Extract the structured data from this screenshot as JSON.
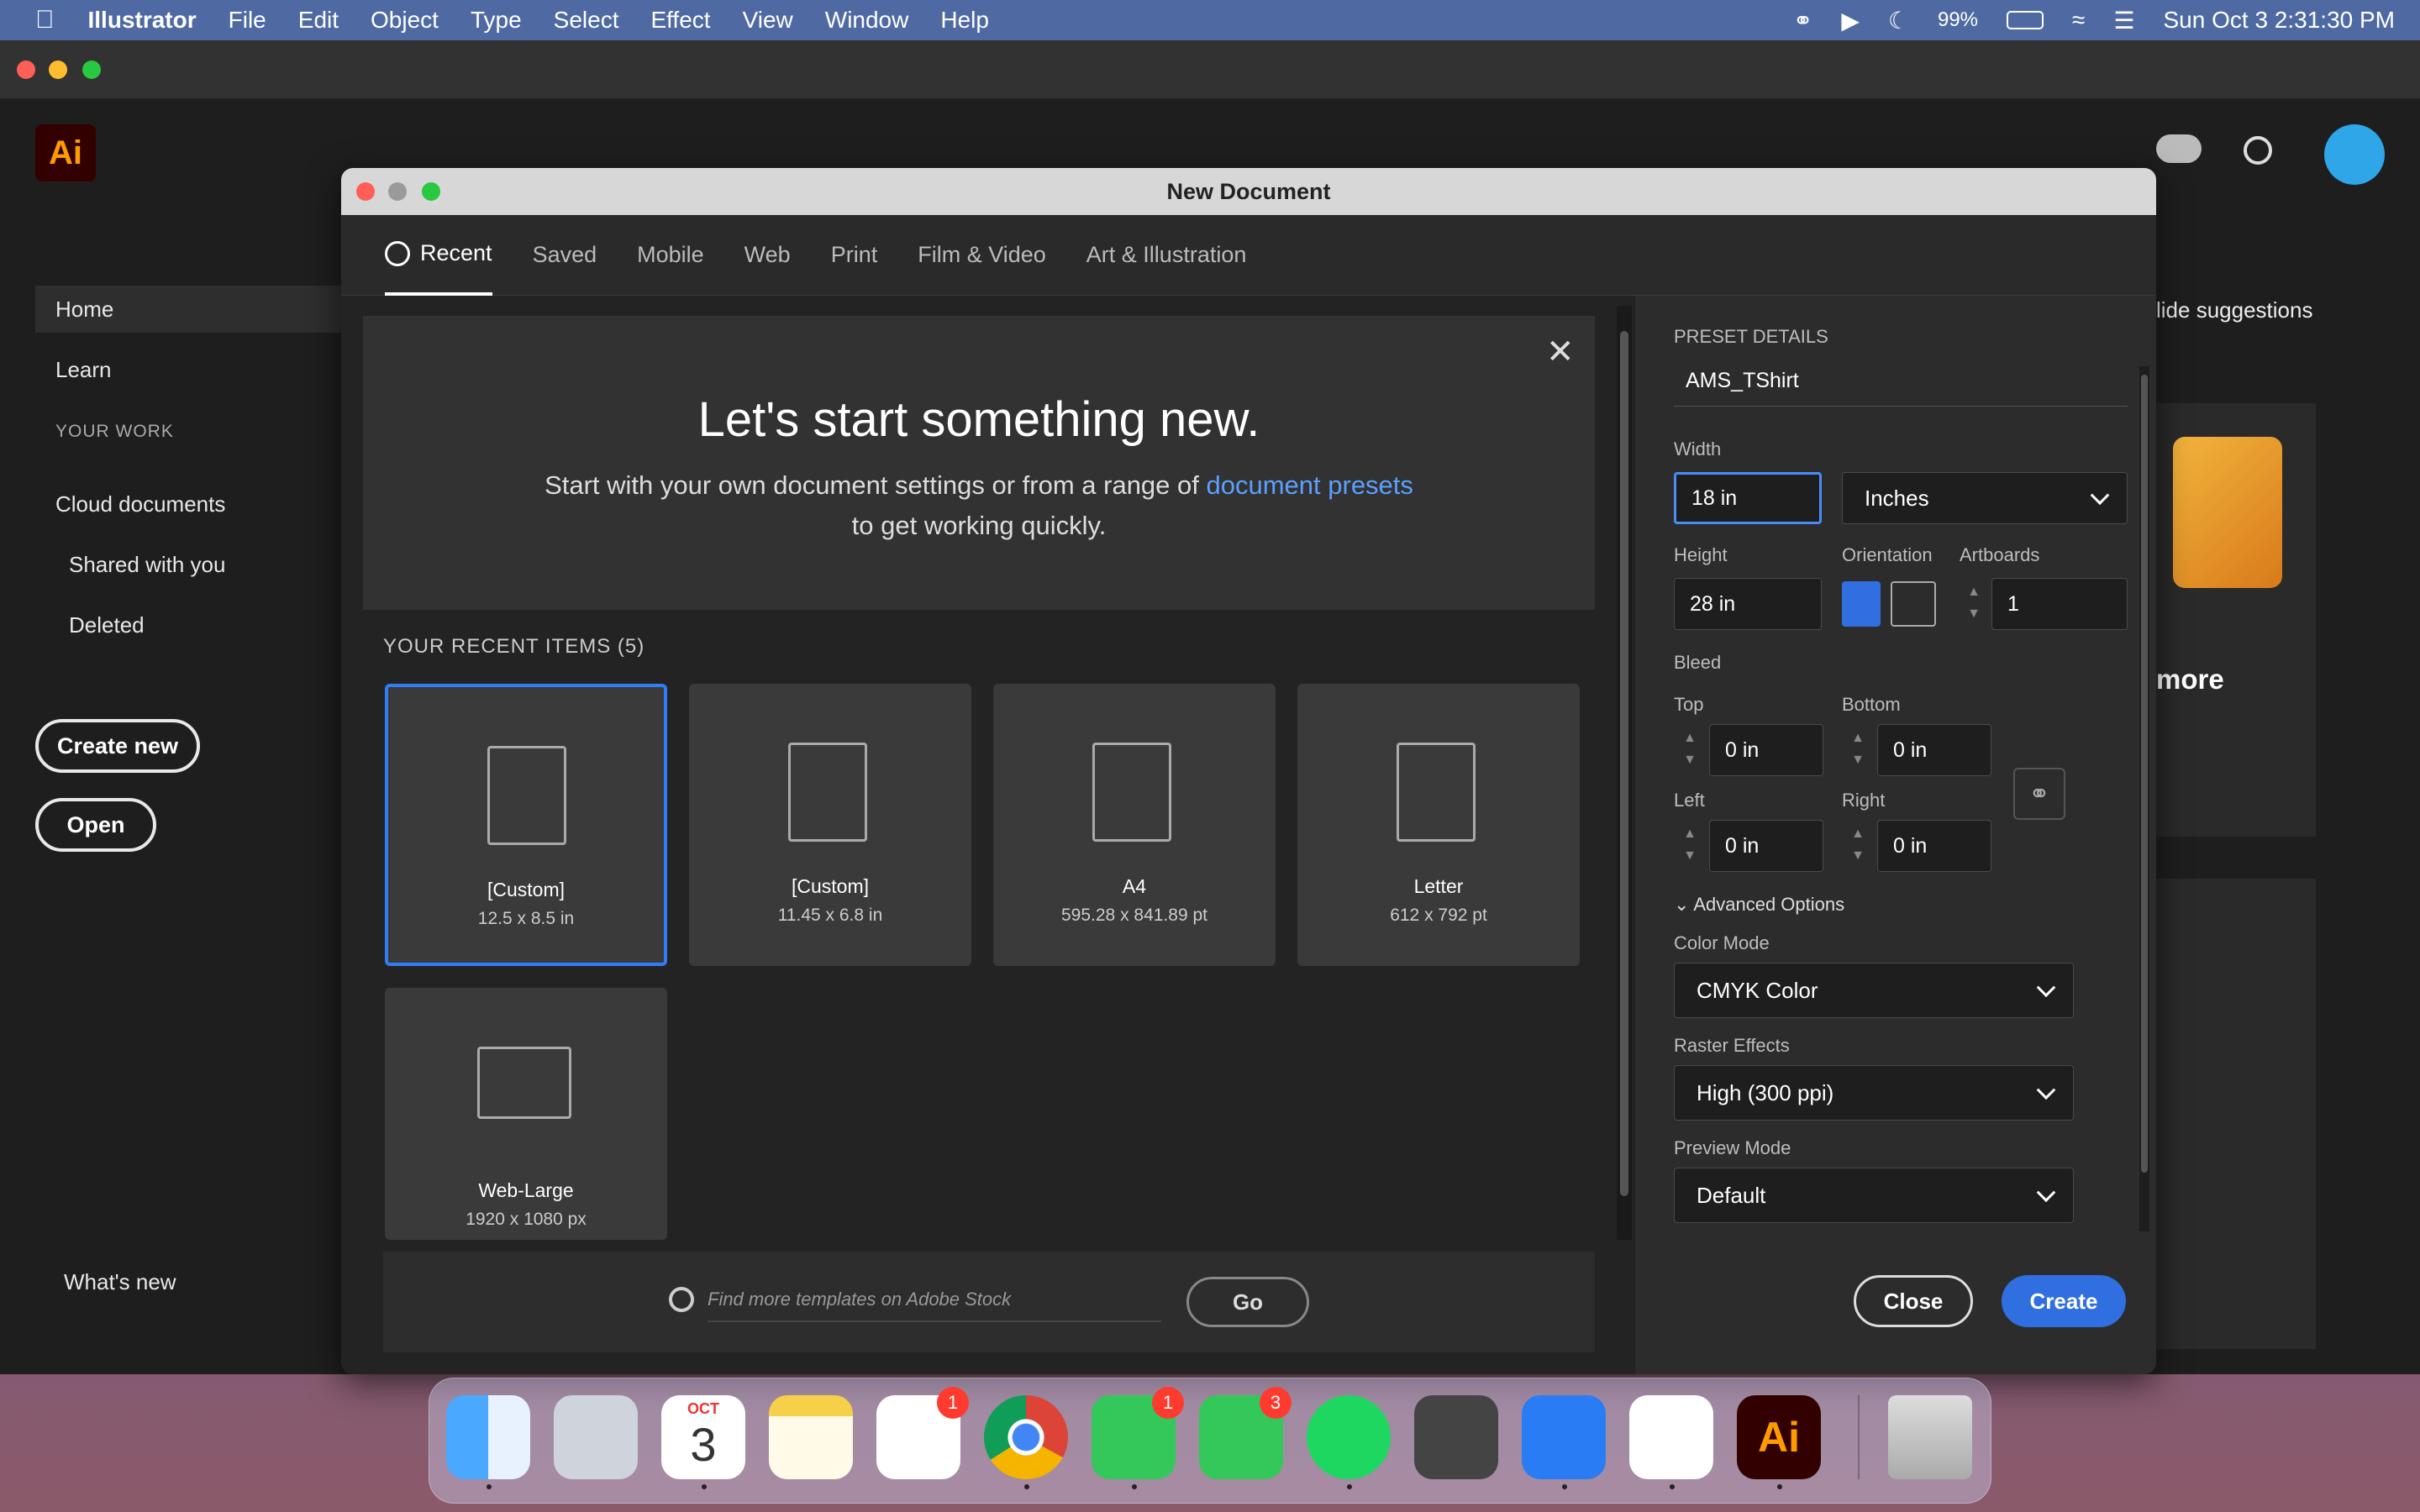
{
  "menubar": {
    "app_name": "Illustrator",
    "menus": [
      "File",
      "Edit",
      "Object",
      "Type",
      "Select",
      "Effect",
      "View",
      "Window",
      "Help"
    ],
    "battery": "99%",
    "clock": "Sun Oct 3  2:31:30 PM"
  },
  "app": {
    "logo": "Ai",
    "sidebar": {
      "home": "Home",
      "learn": "Learn",
      "your_work": "YOUR WORK",
      "cloud_docs": "Cloud documents",
      "shared": "Shared with you",
      "deleted": "Deleted",
      "create_new": "Create new",
      "open": "Open",
      "whats_new": "What's new"
    },
    "bg_right": {
      "hide_suggestions": "lide suggestions",
      "more": "more"
    }
  },
  "dialog": {
    "title": "New Document",
    "tabs": [
      "Recent",
      "Saved",
      "Mobile",
      "Web",
      "Print",
      "Film & Video",
      "Art & Illustration"
    ],
    "hero": {
      "heading": "Let's start something new.",
      "text_before": "Start with your own document settings or from a range of ",
      "link": "document presets",
      "text_after": " to get working quickly."
    },
    "recent_header": "YOUR RECENT ITEMS",
    "recent_count": "(5)",
    "recent_items": [
      {
        "name": "[Custom]",
        "size": "12.5 x 8.5 in"
      },
      {
        "name": "[Custom]",
        "size": "11.45 x 6.8 in"
      },
      {
        "name": "A4",
        "size": "595.28 x 841.89 pt"
      },
      {
        "name": "Letter",
        "size": "612 x 792 pt"
      },
      {
        "name": "Web-Large",
        "size": "1920 x 1080 px"
      }
    ],
    "search_placeholder": "Find more templates on Adobe Stock",
    "go": "Go",
    "preset": {
      "header": "PRESET DETAILS",
      "name": "AMS_TShirt",
      "width_label": "Width",
      "width": "18 in",
      "units": "Inches",
      "height_label": "Height",
      "height": "28 in",
      "orientation_label": "Orientation",
      "artboards_label": "Artboards",
      "artboards": "1",
      "bleed_label": "Bleed",
      "top_label": "Top",
      "top": "0 in",
      "bottom_label": "Bottom",
      "bottom": "0 in",
      "left_label": "Left",
      "left": "0 in",
      "right_label": "Right",
      "right": "0 in",
      "advanced": "Advanced Options",
      "color_mode_label": "Color Mode",
      "color_mode": "CMYK Color",
      "raster_label": "Raster Effects",
      "raster": "High (300 ppi)",
      "preview_label": "Preview Mode",
      "preview": "Default"
    },
    "close": "Close",
    "create": "Create"
  },
  "dock": {
    "calendar_month": "OCT",
    "calendar_day": "3",
    "badges": {
      "reminders": "1",
      "messages": "1",
      "facetime": "3"
    },
    "ai_label": "Ai"
  }
}
